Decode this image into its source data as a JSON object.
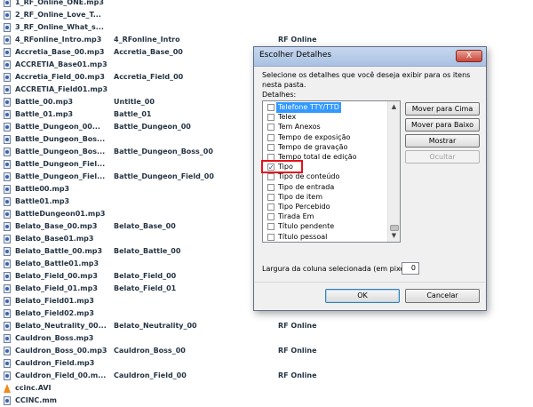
{
  "files": [
    {
      "name": "1_RF_Online_ONE.mp3",
      "title": "",
      "album": "",
      "icon": "audio-file-icon"
    },
    {
      "name": "2_RF_Online_Love_T...",
      "title": "",
      "album": "",
      "icon": "audio-file-icon"
    },
    {
      "name": "3_RF_Online_What_s...",
      "title": "",
      "album": "",
      "icon": "audio-file-icon"
    },
    {
      "name": "4_RFonline_Intro.mp3",
      "title": "4_RFonline_Intro",
      "album": "RF Online",
      "icon": "audio-file-icon"
    },
    {
      "name": "Accretia_Base_00.mp3",
      "title": "Accretia_Base_00",
      "album": "",
      "icon": "audio-file-icon"
    },
    {
      "name": "ACCRETIA_Base01.mp3",
      "title": "",
      "album": "",
      "icon": "audio-file-icon"
    },
    {
      "name": "Accretia_Field_00.mp3",
      "title": "Accretia_Field_00",
      "album": "",
      "icon": "audio-file-icon"
    },
    {
      "name": "ACCRETIA_Field01.mp3",
      "title": "",
      "album": "",
      "icon": "audio-file-icon"
    },
    {
      "name": "Battle_00.mp3",
      "title": "Untitle_00",
      "album": "",
      "icon": "audio-file-icon"
    },
    {
      "name": "Battle_01.mp3",
      "title": "Battle_01",
      "album": "",
      "icon": "audio-file-icon"
    },
    {
      "name": "Battle_Dungeon_00...",
      "title": "Battle_Dungeon_00",
      "album": "",
      "icon": "audio-file-icon"
    },
    {
      "name": "Battle_Dungeon_Bos...",
      "title": "",
      "album": "",
      "icon": "audio-file-icon"
    },
    {
      "name": "Battle_Dungeon_Bos...",
      "title": "Battle_Dungeon_Boss_00",
      "album": "",
      "icon": "audio-file-icon"
    },
    {
      "name": "Battle_Dungeon_Fiel...",
      "title": "",
      "album": "",
      "icon": "audio-file-icon"
    },
    {
      "name": "Battle_Dungeon_Fiel...",
      "title": "Battle_Dungeon_Field_00",
      "album": "",
      "icon": "audio-file-icon"
    },
    {
      "name": "Battle00.mp3",
      "title": "",
      "album": "",
      "icon": "audio-file-icon"
    },
    {
      "name": "Battle01.mp3",
      "title": "",
      "album": "",
      "icon": "audio-file-icon"
    },
    {
      "name": "BattleDungeon01.mp3",
      "title": "",
      "album": "",
      "icon": "audio-file-icon"
    },
    {
      "name": "Belato_Base_00.mp3",
      "title": "Belato_Base_00",
      "album": "",
      "icon": "audio-file-icon"
    },
    {
      "name": "Belato_Base01.mp3",
      "title": "",
      "album": "",
      "icon": "audio-file-icon"
    },
    {
      "name": "Belato_Battle_00.mp3",
      "title": "Belato_Battle_00",
      "album": "",
      "icon": "audio-file-icon"
    },
    {
      "name": "Belato_Battle01.mp3",
      "title": "",
      "album": "",
      "icon": "audio-file-icon"
    },
    {
      "name": "Belato_Field_00.mp3",
      "title": "Belato_Field_00",
      "album": "",
      "icon": "audio-file-icon"
    },
    {
      "name": "Belato_Field_01.mp3",
      "title": "Belato_Field_01",
      "album": "",
      "icon": "audio-file-icon"
    },
    {
      "name": "Belato_Field01.mp3",
      "title": "",
      "album": "",
      "icon": "audio-file-icon"
    },
    {
      "name": "Belato_Field02.mp3",
      "title": "",
      "album": "",
      "icon": "audio-file-icon"
    },
    {
      "name": "Belato_Neutrality_00...",
      "title": "Belato_Neutrality_00",
      "album": "RF Online",
      "icon": "audio-file-icon"
    },
    {
      "name": "Cauldron_Boss.mp3",
      "title": "",
      "album": "",
      "icon": "audio-file-icon"
    },
    {
      "name": "Cauldron_Boss_00.mp3",
      "title": "Cauldron_Boss_00",
      "album": "RF Online",
      "icon": "audio-file-icon"
    },
    {
      "name": "Cauldron_Field.mp3",
      "title": "",
      "album": "",
      "icon": "audio-file-icon"
    },
    {
      "name": "Cauldron_Field_00.m...",
      "title": "Cauldron_Field_00",
      "album": "RF Online",
      "icon": "audio-file-icon"
    },
    {
      "name": "ccinc.AVI",
      "title": "",
      "album": "",
      "icon": "vlc-cone-icon"
    },
    {
      "name": "CCINC.mm",
      "title": "",
      "album": "",
      "icon": "audio-file-icon"
    }
  ],
  "dialog": {
    "title": "Escolher Detalhes",
    "close_label": "X",
    "description": "Selecione os detalhes que você deseja exibir para os itens nesta pasta.",
    "details_label": "Detalhes:",
    "items": [
      {
        "label": "Telefone TTY/TTD",
        "checked": false,
        "selected": true
      },
      {
        "label": "Telex",
        "checked": false,
        "selected": false
      },
      {
        "label": "Tem Anexos",
        "checked": false,
        "selected": false
      },
      {
        "label": "Tempo de exposição",
        "checked": false,
        "selected": false
      },
      {
        "label": "Tempo de gravação",
        "checked": false,
        "selected": false
      },
      {
        "label": "Tempo total de edição",
        "checked": false,
        "selected": false
      },
      {
        "label": "Tipo",
        "checked": true,
        "selected": false
      },
      {
        "label": "Tipo de conteúdo",
        "checked": false,
        "selected": false
      },
      {
        "label": "Tipo de entrada",
        "checked": false,
        "selected": false
      },
      {
        "label": "Tipo de item",
        "checked": false,
        "selected": false
      },
      {
        "label": "Tipo Percebido",
        "checked": false,
        "selected": false
      },
      {
        "label": "Tirada Em",
        "checked": false,
        "selected": false
      },
      {
        "label": "Título pendente",
        "checked": false,
        "selected": false
      },
      {
        "label": "Título pessoal",
        "checked": false,
        "selected": false
      }
    ],
    "buttons": {
      "move_up": "Mover para Cima",
      "move_down": "Mover para Baixo",
      "show": "Mostrar",
      "hide": "Ocultar",
      "ok": "OK",
      "cancel": "Cancelar"
    },
    "width_label": "Largura da coluna selecionada (em pixels):",
    "width_value": "0"
  },
  "colors": {
    "highlight_box": "#e5111b",
    "selection": "#3399ff",
    "titlebar": "#a9c1e3"
  }
}
